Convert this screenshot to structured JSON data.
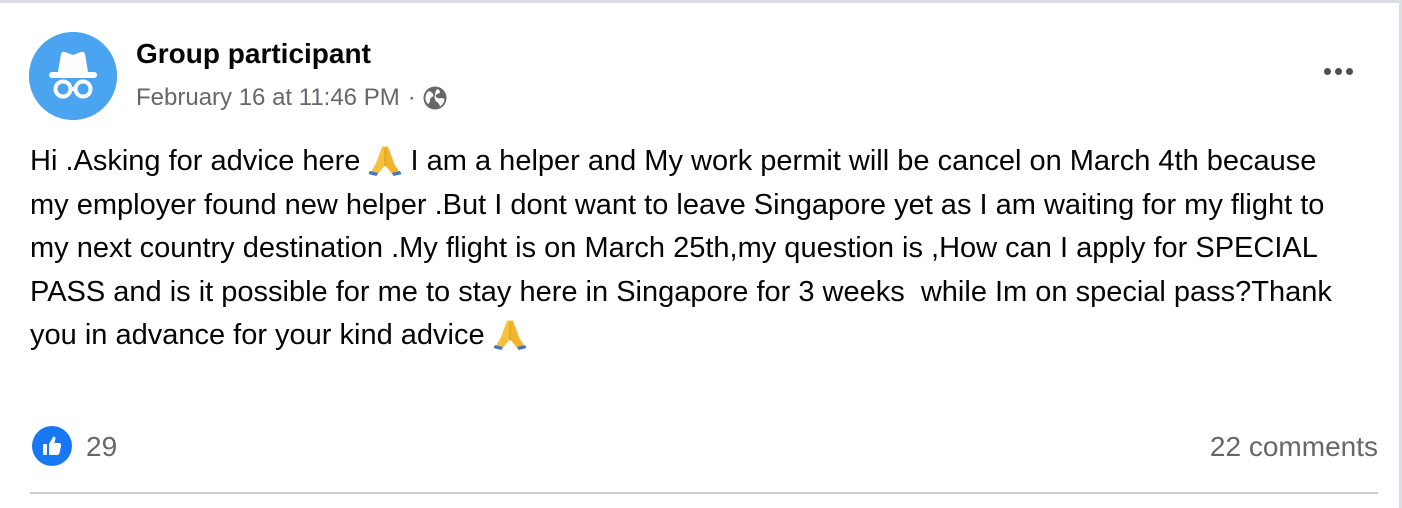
{
  "post": {
    "author": "Group participant",
    "date": "February 16 at 11:46 PM",
    "separator": "·",
    "privacy_icon": "globe-icon",
    "avatar_icon": "anonymous-incognito-icon",
    "more_icon": "more-options-icon",
    "text_before_emoji": "Hi .Asking for advice here ",
    "emoji_1": "folded-hands-emoji",
    "text_after_emoji": " I am a helper and My work permit will be cancel on March 4th because my employer found new helper .But I dont want to leave Singapore yet as I am waiting for my flight to my next country destination .My flight is on March 25th,my question is ,How can I apply for SPECIAL PASS and is it possible for me to stay here in Singapore for 3 weeks  while Im on special pass?Thank you in advance for your kind advice ",
    "emoji_2": "folded-hands-emoji"
  },
  "footer": {
    "like_icon": "thumbs-up-icon",
    "like_count": "29",
    "comments": "22 comments"
  },
  "colors": {
    "avatar_bg": "#4aa4f0",
    "like_blue": "#1877f2",
    "secondary_text": "#65676b",
    "primary_text": "#050505"
  }
}
